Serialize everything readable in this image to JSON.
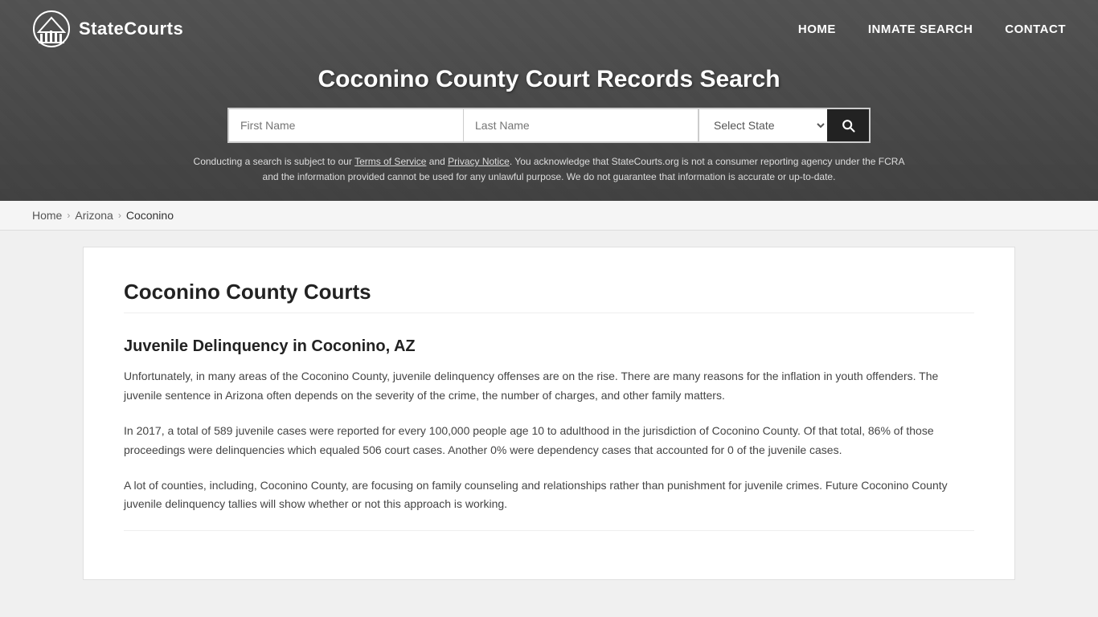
{
  "logo": {
    "text": "StateCourts"
  },
  "nav": {
    "home_label": "HOME",
    "inmate_search_label": "INMATE SEARCH",
    "contact_label": "CONTACT"
  },
  "search": {
    "title": "Coconino County Court Records Search",
    "first_name_placeholder": "First Name",
    "last_name_placeholder": "Last Name",
    "state_placeholder": "Select State",
    "disclaimer": "Conducting a search is subject to our Terms of Service and Privacy Notice. You acknowledge that StateCourts.org is not a consumer reporting agency under the FCRA and the information provided cannot be used for any unlawful purpose. We do not guarantee that information is accurate or up-to-date."
  },
  "breadcrumb": {
    "home": "Home",
    "state": "Arizona",
    "county": "Coconino"
  },
  "content": {
    "page_title": "Coconino County Courts",
    "section1_heading": "Juvenile Delinquency in Coconino, AZ",
    "section1_p1": "Unfortunately, in many areas of the Coconino County, juvenile delinquency offenses are on the rise. There are many reasons for the inflation in youth offenders. The juvenile sentence in Arizona often depends on the severity of the crime, the number of charges, and other family matters.",
    "section1_p2": "In 2017, a total of 589 juvenile cases were reported for every 100,000 people age 10 to adulthood in the jurisdiction of Coconino County. Of that total, 86% of those proceedings were delinquencies which equaled 506 court cases. Another 0% were dependency cases that accounted for 0 of the juvenile cases.",
    "section1_p3": "A lot of counties, including, Coconino County, are focusing on family counseling and relationships rather than punishment for juvenile crimes. Future Coconino County juvenile delinquency tallies will show whether or not this approach is working."
  }
}
